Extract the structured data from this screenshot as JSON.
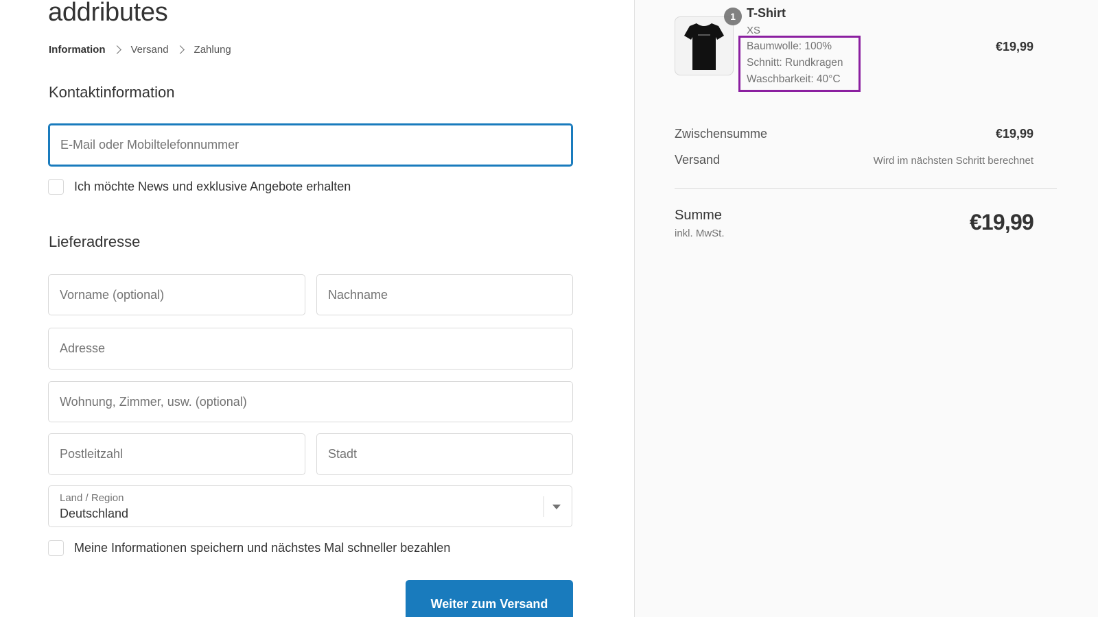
{
  "store": {
    "title": "addributes"
  },
  "breadcrumb": {
    "steps": [
      "Information",
      "Versand",
      "Zahlung"
    ]
  },
  "contact": {
    "heading": "Kontaktinformation",
    "email_placeholder": "E-Mail oder Mobiltelefonnummer",
    "newsletter_label": "Ich möchte News und exklusive Angebote erhalten"
  },
  "shipping_address": {
    "heading": "Lieferadresse",
    "first_name_placeholder": "Vorname (optional)",
    "last_name_placeholder": "Nachname",
    "address_placeholder": "Adresse",
    "apartment_placeholder": "Wohnung, Zimmer, usw. (optional)",
    "zip_placeholder": "Postleitzahl",
    "city_placeholder": "Stadt",
    "country_label": "Land / Region",
    "country_value": "Deutschland",
    "save_info_label": "Meine Informationen speichern und nächstes Mal schneller bezahlen"
  },
  "actions": {
    "continue_label": "Weiter zum Versand"
  },
  "order_summary": {
    "item": {
      "quantity": "1",
      "name": "T-Shirt",
      "variant": "XS",
      "attributes": [
        "Baumwolle: 100%",
        "Schnitt: Rundkragen",
        "Waschbarkeit: 40°C"
      ],
      "price": "€19,99"
    },
    "subtotal_label": "Zwischensumme",
    "subtotal_value": "€19,99",
    "shipping_label": "Versand",
    "shipping_value": "Wird im nächsten Schritt berechnet",
    "total_label": "Summe",
    "total_sub": "inkl. MwSt.",
    "total_value": "€19,99"
  },
  "colors": {
    "accent": "#197bbd",
    "highlight_box": "#8b1fa0",
    "sidebar_bg": "#fafafa"
  }
}
